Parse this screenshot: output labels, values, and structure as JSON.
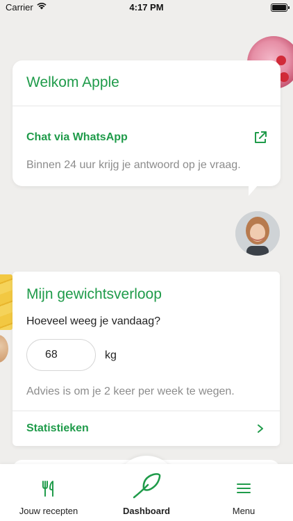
{
  "status_bar": {
    "carrier": "Carrier",
    "time": "4:17 PM"
  },
  "welcome": {
    "title": "Welkom Apple",
    "chat_label": "Chat via WhatsApp",
    "chat_note": "Binnen 24 uur krijg je antwoord op je vraag."
  },
  "weight": {
    "title": "Mijn gewichtsverloop",
    "question": "Hoeveel weeg je vandaag?",
    "value": "68",
    "unit": "kg",
    "advice": "Advies is om je 2 keer per week te wegen.",
    "stats_label": "Statistieken"
  },
  "tabs": [
    {
      "label": "Jouw recepten",
      "icon": "cutlery-icon"
    },
    {
      "label": "Dashboard",
      "icon": "leaf-icon",
      "active": true
    },
    {
      "label": "Menu",
      "icon": "hamburger-menu-icon"
    }
  ],
  "colors": {
    "accent": "#1f9b4a",
    "muted_text": "#8c8c8c",
    "background": "#efeeec"
  }
}
